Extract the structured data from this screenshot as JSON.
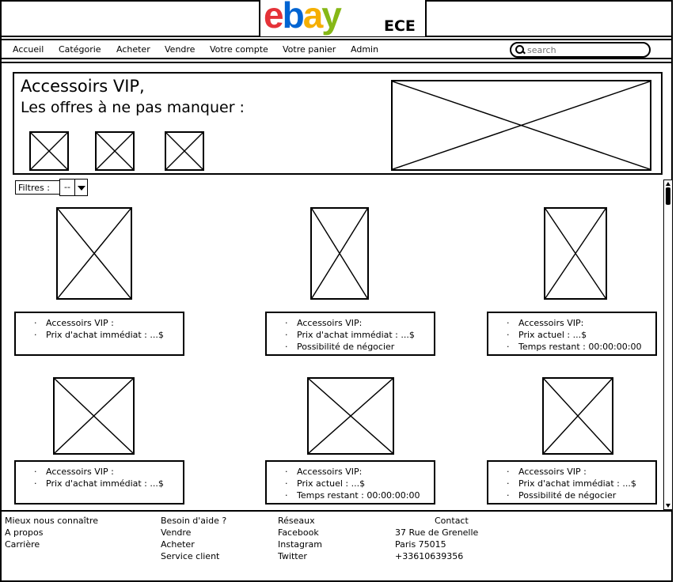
{
  "brand": {
    "logo_text": "ebay",
    "suffix": "ECE"
  },
  "nav": {
    "items": [
      "Accueil",
      "Catégorie",
      "Acheter",
      "Vendre",
      "Votre compte",
      "Votre panier",
      "Admin"
    ],
    "search_placeholder": "search"
  },
  "hero": {
    "title_line1": "Accessoirs VIP,",
    "title_line2": "Les offres à ne pas manquer :"
  },
  "filters": {
    "label": "Filtres :",
    "selected": "--"
  },
  "products": [
    {
      "lines": [
        "Accessoirs VIP :",
        "Prix d'achat immédiat : ...$"
      ]
    },
    {
      "lines": [
        "Accessoirs VIP:",
        "Prix d'achat immédiat : ...$",
        "Possibilité de négocier"
      ]
    },
    {
      "lines": [
        "Accessoirs VIP:",
        "Prix actuel : ...$",
        "Temps restant : 00:00:00:00"
      ]
    },
    {
      "lines": [
        "Accessoirs VIP :",
        "Prix d'achat immédiat : ...$"
      ]
    },
    {
      "lines": [
        "Accessoirs VIP:",
        "Prix actuel : ...$",
        "Temps restant : 00:00:00:00"
      ]
    },
    {
      "lines": [
        "Accessoirs VIP :",
        "Prix d'achat immédiat : ...$",
        "Possibilité de négocier"
      ]
    }
  ],
  "footer": {
    "col1": [
      "Mieux nous connaître",
      "A propos",
      "Carrière"
    ],
    "col2": [
      "Besoin d'aide ?",
      "Vendre",
      "Acheter",
      "Service client"
    ],
    "col3": [
      "Réseaux",
      "Facebook",
      "Instagram",
      "Twitter"
    ],
    "col4_title": "Contact",
    "col4": [
      "37 Rue de Grenelle",
      "Paris 75015",
      "+33610639356"
    ]
  },
  "colors": {
    "ebay_e": "#e53238",
    "ebay_b": "#0064d2",
    "ebay_a": "#f5af02",
    "ebay_y": "#86b817"
  }
}
